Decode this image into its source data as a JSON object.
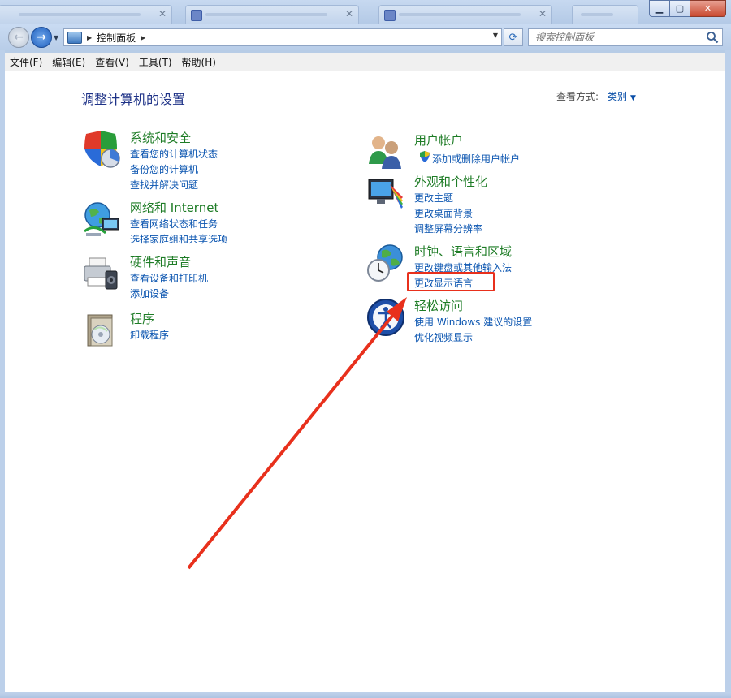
{
  "window": {
    "buttons": {
      "minimize": "▁",
      "maximize": "▢",
      "close": "✕"
    }
  },
  "address_bar": {
    "path": "控制面板",
    "search_placeholder": "搜索控制面板"
  },
  "menu": [
    "文件(F)",
    "编辑(E)",
    "查看(V)",
    "工具(T)",
    "帮助(H)"
  ],
  "main": {
    "title": "调整计算机的设置",
    "view_by_label": "查看方式:",
    "view_by_value": "类别"
  },
  "categories_left": [
    {
      "title": "系统和安全",
      "icon": "shield-icon",
      "links": [
        "查看您的计算机状态",
        "备份您的计算机",
        "查找并解决问题"
      ]
    },
    {
      "title": "网络和 Internet",
      "icon": "network-globe-icon",
      "links": [
        "查看网络状态和任务",
        "选择家庭组和共享选项"
      ]
    },
    {
      "title": "硬件和声音",
      "icon": "printer-icon",
      "links": [
        "查看设备和打印机",
        "添加设备"
      ]
    },
    {
      "title": "程序",
      "icon": "programs-disc-icon",
      "links": [
        "卸载程序"
      ]
    }
  ],
  "categories_right": [
    {
      "title": "用户帐户",
      "icon": "users-icon",
      "links": [
        "添加或删除用户帐户"
      ]
    },
    {
      "title": "外观和个性化",
      "icon": "monitor-colors-icon",
      "links": [
        "更改主题",
        "更改桌面背景",
        "调整屏幕分辨率"
      ]
    },
    {
      "title": "时钟、语言和区域",
      "icon": "clock-globe-icon",
      "links": [
        "更改键盘或其他输入法",
        "更改显示语言"
      ]
    },
    {
      "title": "轻松访问",
      "icon": "accessibility-icon",
      "links": [
        "使用 Windows 建议的设置",
        "优化视频显示"
      ]
    }
  ],
  "colors": {
    "category_title": "#1e7c26",
    "link": "#0b55b0",
    "page_title": "#1e3287",
    "annotation": "#e8301c"
  }
}
